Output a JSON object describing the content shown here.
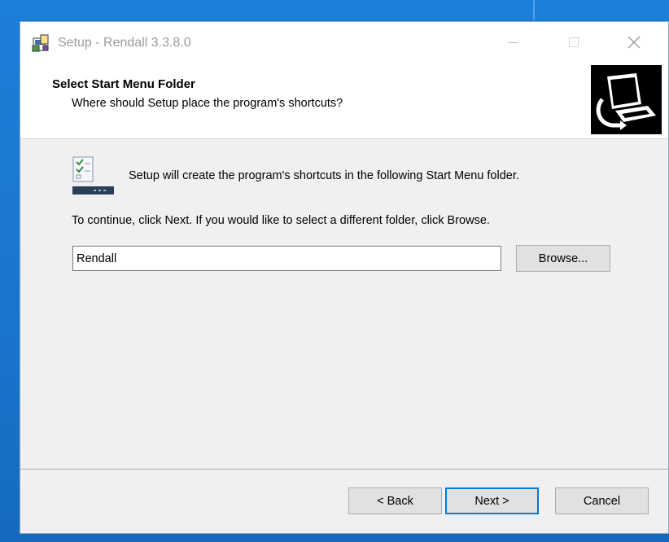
{
  "window": {
    "title": "Setup - Rendall 3.3.8.0",
    "controls": {
      "minimize": "—",
      "maximize": "☐",
      "close": "✕"
    }
  },
  "header": {
    "title": "Select Start Menu Folder",
    "subtitle": "Where should Setup place the program's shortcuts?"
  },
  "content": {
    "message": "Setup will create the program's shortcuts in the following Start Menu folder.",
    "instruction": "To continue, click Next. If you would like to select a different folder, click Browse.",
    "folder_value": "Rendall",
    "browse_label": "Browse..."
  },
  "footer": {
    "back_label": "< Back",
    "next_label": "Next >",
    "cancel_label": "Cancel"
  },
  "colors": {
    "desktop": "#1a75cc",
    "window_bg": "#f0f0f0",
    "default_button_border": "#0078d7"
  },
  "icons": {
    "app": "setup-installer-icon",
    "header": "computer-install-icon",
    "folder": "start-menu-folder-icon"
  }
}
